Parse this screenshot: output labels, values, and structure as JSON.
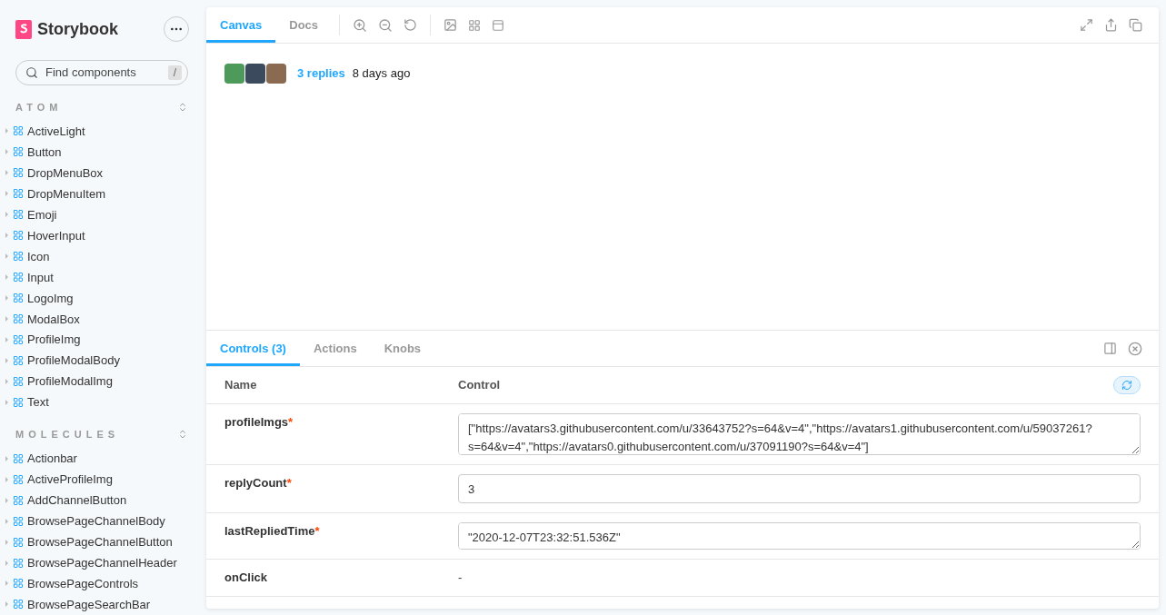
{
  "sidebar": {
    "brand": "Storybook",
    "search": {
      "placeholder": "Find components",
      "shortcut": "/"
    },
    "groups": [
      {
        "title": "ATOM",
        "items": [
          "ActiveLight",
          "Button",
          "DropMenuBox",
          "DropMenuItem",
          "Emoji",
          "HoverInput",
          "Icon",
          "Input",
          "LogoImg",
          "ModalBox",
          "ProfileImg",
          "ProfileModalBody",
          "ProfileModalImg",
          "Text"
        ]
      },
      {
        "title": "MOLECULES",
        "items": [
          "Actionbar",
          "ActiveProfileImg",
          "AddChannelButton",
          "BrowsePageChannelBody",
          "BrowsePageChannelButton",
          "BrowsePageChannelHeader",
          "BrowsePageControls",
          "BrowsePageSearchBar"
        ]
      }
    ]
  },
  "toolbar": {
    "tabs": [
      {
        "label": "Canvas",
        "selected": true
      },
      {
        "label": "Docs",
        "selected": false
      }
    ]
  },
  "canvas": {
    "avatars": [
      {
        "kind": "photo"
      },
      {
        "kind": "photo"
      },
      {
        "kind": "photo"
      }
    ],
    "replies": "3 replies",
    "time": "8 days ago"
  },
  "addons": {
    "tabs": [
      {
        "label": "Controls (3)",
        "selected": true
      },
      {
        "label": "Actions",
        "selected": false
      },
      {
        "label": "Knobs",
        "selected": false
      }
    ],
    "columns": [
      "Name",
      "Control"
    ],
    "rows": [
      {
        "name": "profileImgs",
        "required_mark": "*",
        "kind": "textarea",
        "value": "[\"https://avatars3.githubusercontent.com/u/33643752?s=64&v=4\",\"https://avatars1.githubusercontent.com/u/59037261?s=64&v=4\",\"https://avatars0.githubusercontent.com/u/37091190?s=64&v=4\"]"
      },
      {
        "name": "replyCount",
        "required_mark": "*",
        "kind": "input",
        "value": "3"
      },
      {
        "name": "lastRepliedTime",
        "required_mark": "*",
        "kind": "textarea",
        "value": "\"2020-12-07T23:32:51.536Z\""
      },
      {
        "name": "onClick",
        "kind": "none",
        "value": "-"
      }
    ]
  }
}
